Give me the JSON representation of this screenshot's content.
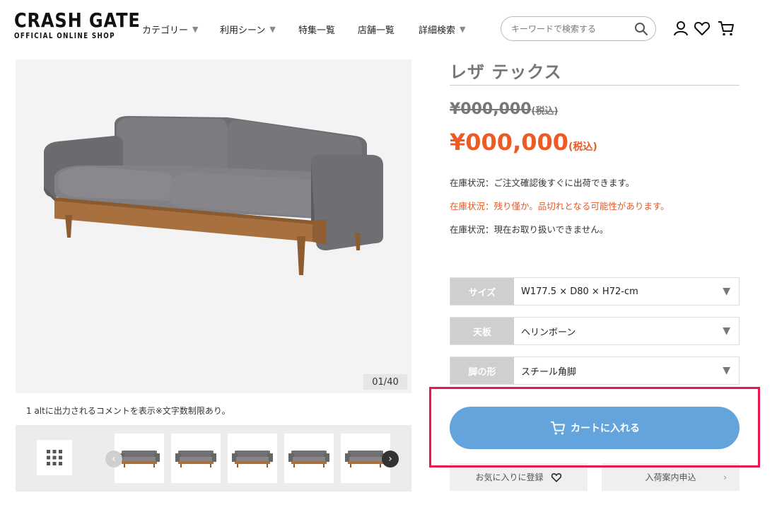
{
  "header": {
    "logo_main": "CRASH GATE",
    "logo_sub": "OFFICIAL ONLINE SHOP",
    "nav": [
      {
        "label": "カテゴリー",
        "dropdown": true
      },
      {
        "label": "利用シーン",
        "dropdown": true
      },
      {
        "label": "特集一覧",
        "dropdown": false
      },
      {
        "label": "店舗一覧",
        "dropdown": false
      },
      {
        "label": "詳細検索",
        "dropdown": true
      }
    ],
    "search_placeholder": "キーワードで検索する",
    "icons": [
      "user-icon",
      "heart-icon",
      "cart-icon"
    ]
  },
  "gallery": {
    "counter": "01/40",
    "caption": "1 altに出力されるコメントを表示※文字数制限あり。"
  },
  "product": {
    "title": "レザ テックス",
    "old_price": "¥000,000",
    "old_price_tax": "(税込)",
    "price": "¥000,000",
    "price_tax": "(税込)",
    "stock": [
      {
        "text": "在庫状況：ご注文確認後すぐに出荷できます。",
        "warn": false
      },
      {
        "text": "在庫状況：残り僅か。品切れとなる可能性があります。",
        "warn": true
      },
      {
        "text": "在庫状況：現在お取り扱いできません。",
        "warn": false
      }
    ],
    "options": [
      {
        "label": "サイズ",
        "value": "W177.5 × D80 × H72-cm"
      },
      {
        "label": "天板",
        "value": "ヘリンボーン"
      },
      {
        "label": "脚の形",
        "value": "スチール角脚"
      }
    ],
    "cart_label": "カートに入れる",
    "favorite_label": "お気に入りに登録",
    "restock_label": "入荷案内申込"
  },
  "colors": {
    "accent_price": "#ee5a24",
    "cart_button": "#64a4dc",
    "highlight_border": "#e8174d"
  }
}
